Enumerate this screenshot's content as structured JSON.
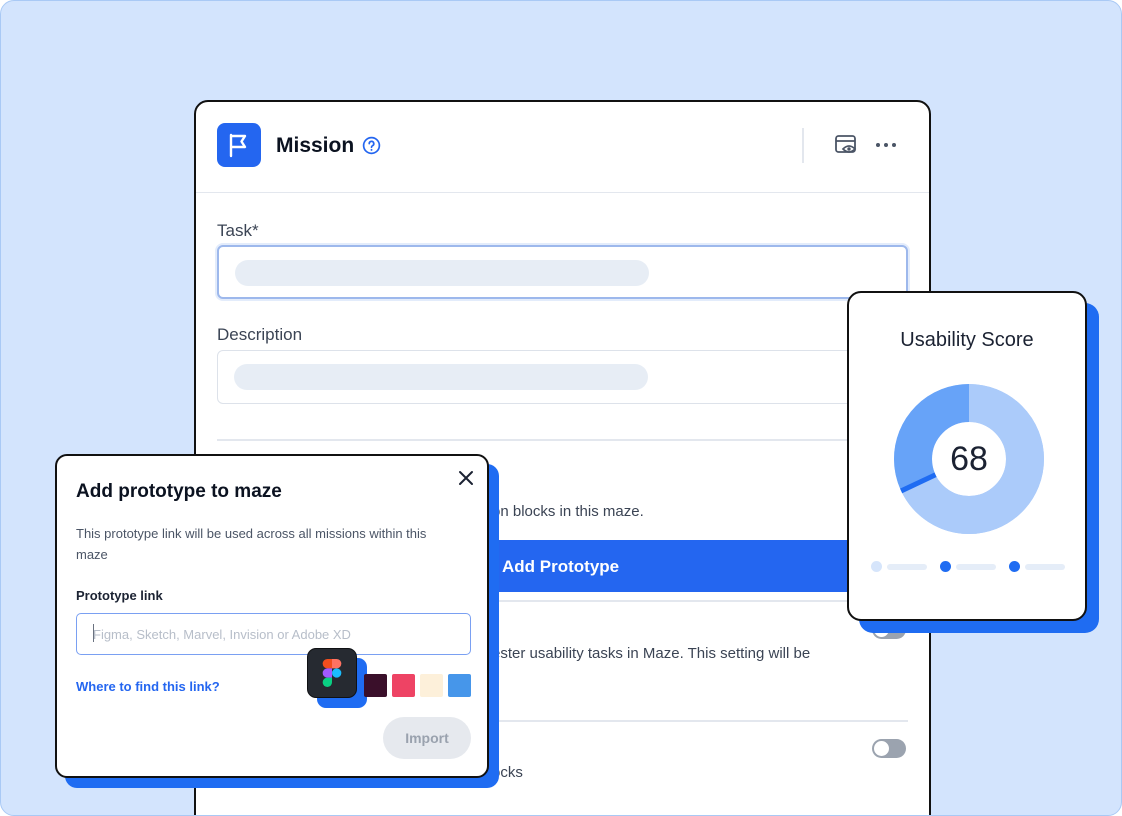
{
  "mission": {
    "title": "Mission",
    "task_label": "Task*",
    "description_label": "Description",
    "fragment_blocks": "on blocks in this maze.",
    "add_prototype_label": "Add Prototype",
    "fragment_tester": "ester usability tasks in Maze. This setting will be",
    "fragment_ocks": "ocks",
    "accent_color": "#2466f0"
  },
  "usability": {
    "title": "Usability Score",
    "score": 68,
    "score_label": "68",
    "max": 100
  },
  "modal": {
    "title": "Add prototype to maze",
    "description": "This prototype link will be used across all missions within this maze",
    "link_label": "Prototype link",
    "link_placeholder": "Figma, Sketch, Marvel, Invision or Adobe XD",
    "link_value": "",
    "help_link": "Where to find this link?",
    "import_label": "Import",
    "swatches": [
      "#3a0f2a",
      "#ee4364",
      "#fdf0da",
      "#4696ea"
    ]
  },
  "icons": {
    "flag": "flag-icon",
    "help": "help-icon",
    "preview": "preview-icon",
    "more": "more-icon",
    "close": "close-icon",
    "figma": "figma-icon"
  }
}
